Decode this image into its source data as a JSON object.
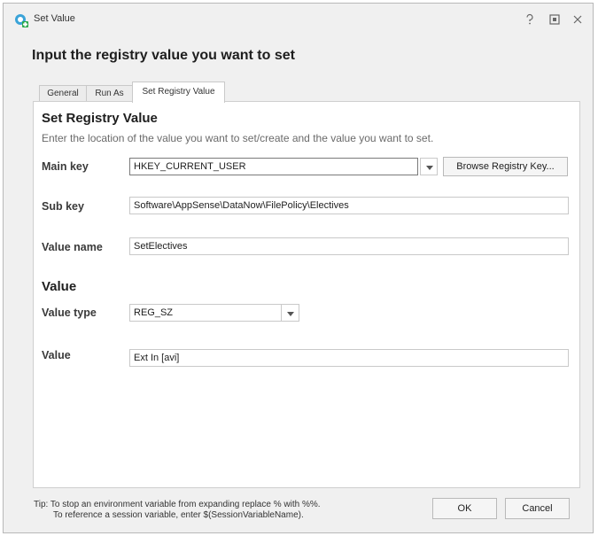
{
  "window": {
    "title": "Set Value"
  },
  "dialog": {
    "heading": "Input the registry value you want to set"
  },
  "tabs": [
    {
      "label": "General"
    },
    {
      "label": "Run As"
    },
    {
      "label": "Set Registry Value"
    }
  ],
  "section_registry": {
    "title": "Set Registry Value",
    "description": "Enter the location of the value you want to set/create and the value you want to set."
  },
  "fields": {
    "main_key": {
      "label": "Main key",
      "value": "HKEY_CURRENT_USER"
    },
    "browse_button": "Browse Registry Key...",
    "sub_key": {
      "label": "Sub key",
      "value": "Software\\AppSense\\DataNow\\FilePolicy\\Electives"
    },
    "value_name": {
      "label": "Value name",
      "value": "SetElectives"
    }
  },
  "section_value": {
    "title": "Value"
  },
  "value_fields": {
    "value_type": {
      "label": "Value type",
      "value": "REG_SZ"
    },
    "value": {
      "label": "Value",
      "value": "Ext In [avi]"
    }
  },
  "footer": {
    "tip_line1": "Tip: To stop an environment variable from expanding replace % with %%.",
    "tip_line2": "To reference a session variable, enter $(SessionVariableName).",
    "ok_label": "OK",
    "cancel_label": "Cancel"
  },
  "icons": {
    "app": "registry-app-icon",
    "help": "help-icon",
    "maximize": "maximize-icon",
    "close": "close-icon",
    "dropdown": "chevron-down-icon"
  }
}
